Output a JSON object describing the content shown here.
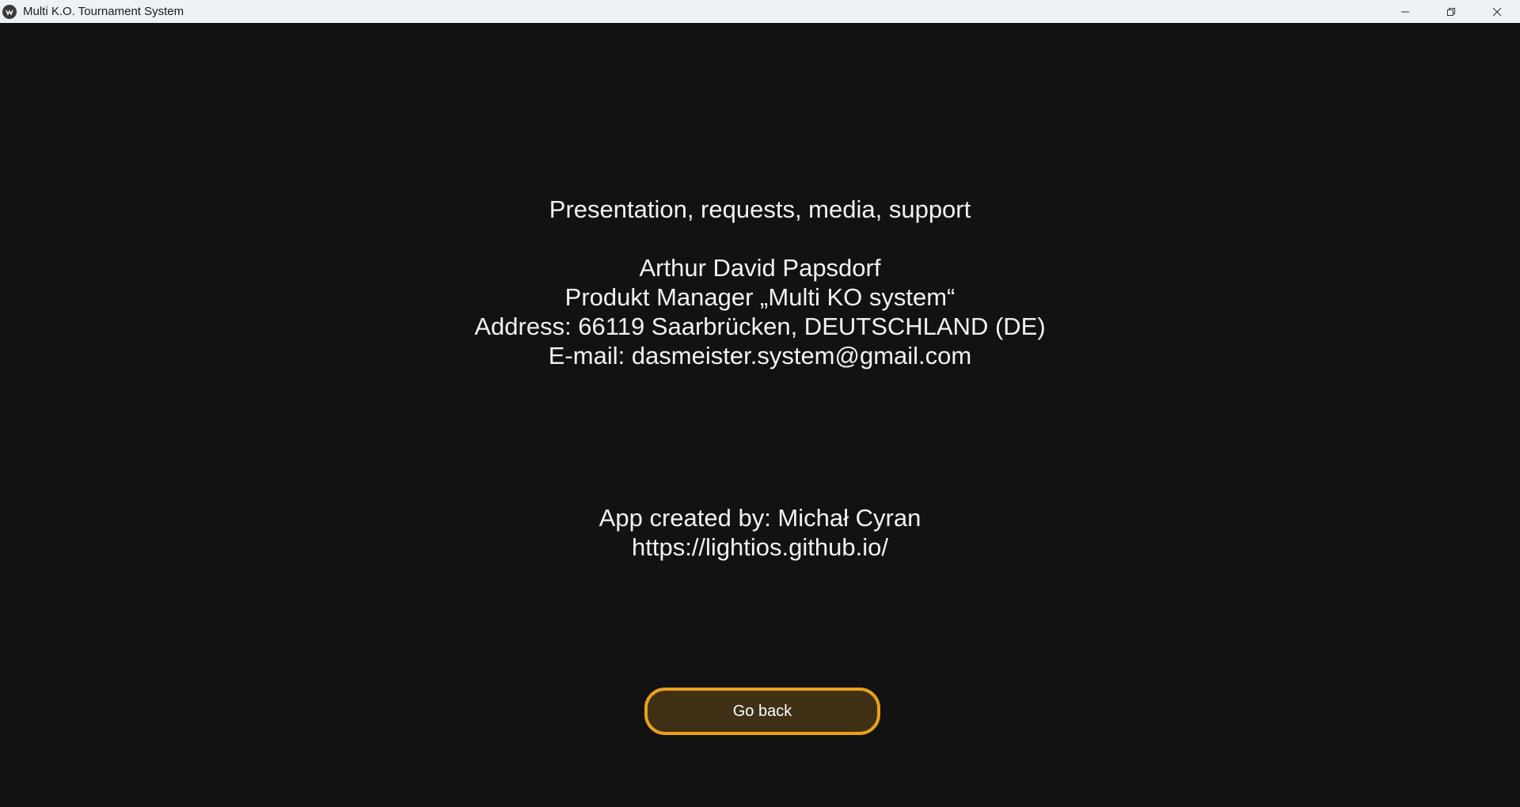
{
  "window": {
    "title": "Multi K.O. Tournament System"
  },
  "contact": {
    "heading": "Presentation, requests, media, support",
    "name": "Arthur David Papsdorf",
    "role": "Produkt Manager „Multi KO system“",
    "address": "Address: 66119 Saarbrücken, DEUTSCHLAND (DE)",
    "email": "E-mail: dasmeister.system@gmail.com"
  },
  "credits": {
    "author": "App created by: Michał Cyran",
    "url": "https://lightios.github.io/"
  },
  "actions": {
    "go_back_label": "Go back"
  },
  "colors": {
    "background": "#121212",
    "button_border": "#e8a219",
    "button_fill": "#3f3016",
    "text": "#f2f2f2"
  }
}
